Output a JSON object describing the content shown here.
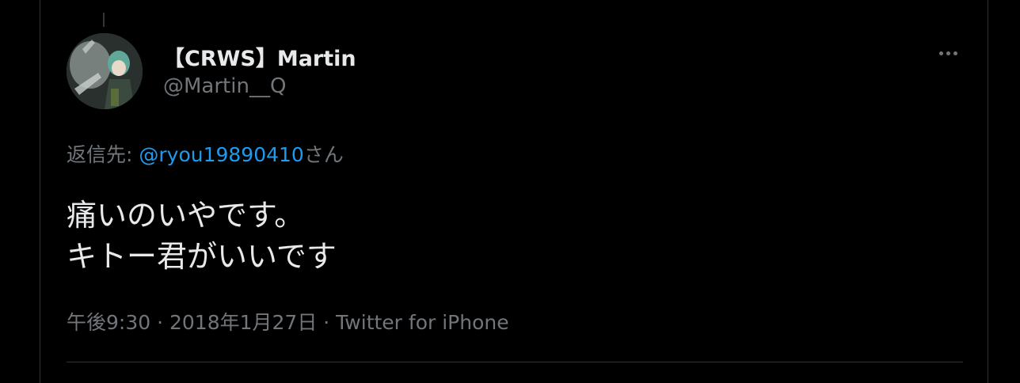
{
  "tweet": {
    "display_name": "【CRWS】Martin",
    "handle": "@Martin__Q",
    "reply_prefix": "返信先: ",
    "reply_mention": "@ryou19890410",
    "reply_suffix": "さん",
    "text_line1": "痛いのいやです。",
    "text_line2": "キトー君がいいです",
    "time": "午後9:30",
    "separator1": " · ",
    "date": "2018年1月27日",
    "separator2": " · ",
    "source": "Twitter for iPhone"
  },
  "icons": {
    "more": "more-horizontal-icon"
  },
  "colors": {
    "background": "#000000",
    "text": "#e7e9ea",
    "secondary": "#71767b",
    "link": "#1d9bf0",
    "border": "#2f3336"
  }
}
